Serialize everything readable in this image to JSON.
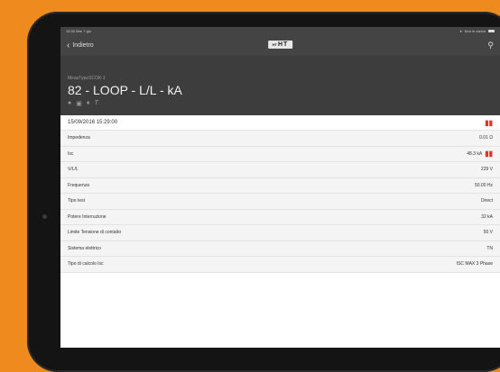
{
  "status": {
    "left": "15:30 Mar 7 giu",
    "right": "Non in carica"
  },
  "nav": {
    "back_label": "Indietro",
    "logo_prefix": "HT",
    "logo_text": "HT"
  },
  "header": {
    "subtitle": "MeasTypeSCOK-1",
    "title": "82 - LOOP - L/L - kA"
  },
  "record": {
    "datetime": "15/09/2016 15:29:00"
  },
  "rows": [
    {
      "label": "Impedenza",
      "value": "0.01 Ω",
      "flag": false
    },
    {
      "label": "Isc",
      "value": "48.3 kA",
      "flag": true
    },
    {
      "label": "V/L/L",
      "value": "229 V",
      "flag": false
    },
    {
      "label": "Frequenza",
      "value": "50.00 Hz",
      "flag": false
    },
    {
      "label": "Tipo test",
      "value": "Direct",
      "flag": false
    },
    {
      "label": "Potere Interruzione",
      "value": "32 kA",
      "flag": false
    },
    {
      "label": "Limite Tensione di contatto",
      "value": "50 V",
      "flag": false
    },
    {
      "label": "Sistema elettrico",
      "value": "TN",
      "flag": false
    },
    {
      "label": "Tipo di calcolo Isc",
      "value": "ISC MAX 3 Phase",
      "flag": false
    }
  ],
  "colors": {
    "background": "#ee8a1e",
    "flag": "#d9382a"
  }
}
